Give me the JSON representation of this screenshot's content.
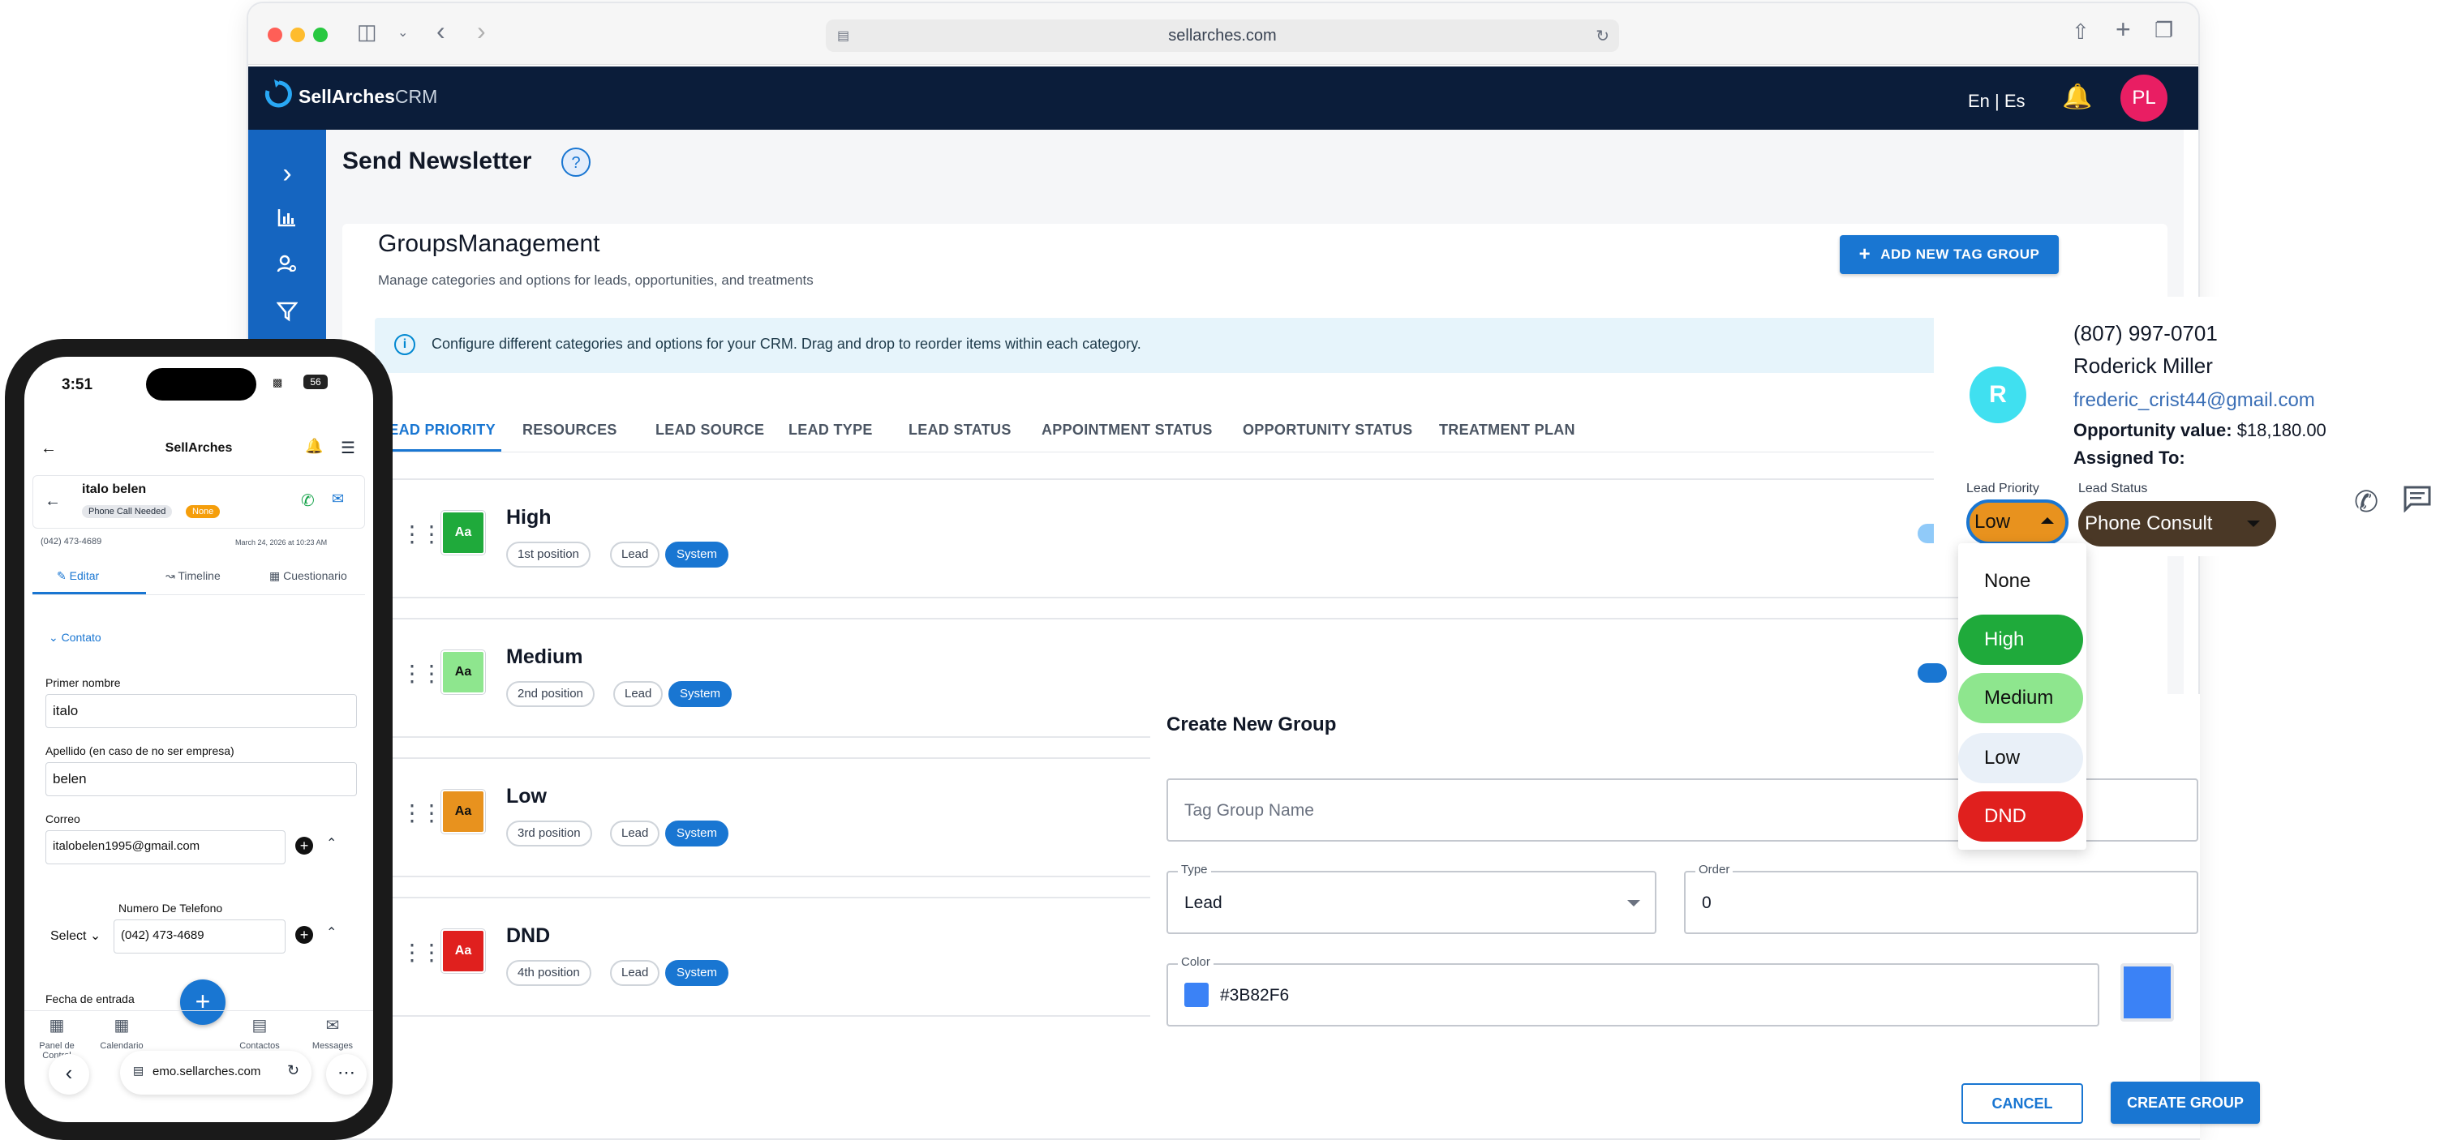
{
  "browser": {
    "url": "sellarches.com"
  },
  "app": {
    "logo_brand": "SellArches",
    "logo_suffix": "CRM",
    "lang": "En | Es",
    "user_initials": "PL"
  },
  "page": {
    "title": "Send Newsletter",
    "help_icon": "?"
  },
  "groups": {
    "title": "GroupsManagement",
    "description": "Manage categories and options for leads, opportunities, and treatments",
    "add_button": "ADD NEW TAG GROUP",
    "info_text": "Configure different categories and options for your CRM. Drag and drop to reorder items within each category.",
    "tabs": [
      "LEAD PRIORITY",
      "RESOURCES",
      "LEAD SOURCE",
      "LEAD TYPE",
      "LEAD STATUS",
      "APPOINTMENT STATUS",
      "OPPORTUNITY STATUS",
      "TREATMENT PLAN"
    ],
    "active_tab": "LEAD PRIORITY",
    "rows": [
      {
        "name": "High",
        "swatch": "Aa",
        "color": "#1faa3b",
        "position": "1st position",
        "type": "Lead",
        "badge": "System"
      },
      {
        "name": "Medium",
        "swatch": "Aa",
        "color": "#8ee68e",
        "position": "2nd position",
        "type": "Lead",
        "badge": "System"
      },
      {
        "name": "Low",
        "swatch": "Aa",
        "color": "#e8921e",
        "position": "3rd position",
        "type": "Lead",
        "badge": "System"
      },
      {
        "name": "DND",
        "swatch": "Aa",
        "color": "#e0201e",
        "position": "4th position",
        "type": "Lead",
        "badge": "System"
      }
    ]
  },
  "dialog": {
    "title": "Create New Group",
    "name_placeholder": "Tag Group Name",
    "type_label": "Type",
    "type_value": "Lead",
    "order_label": "Order",
    "order_value": "0",
    "color_label": "Color",
    "color_value": "#3B82F6",
    "cancel": "CANCEL",
    "create": "CREATE GROUP"
  },
  "lead": {
    "avatar": "R",
    "phone": "(807) 997-0701",
    "name": "Roderick Miller",
    "email": "frederic_crist44@gmail.com",
    "opp_label": "Opportunity value:",
    "opp_value": "$18,180.00",
    "assigned_label": "Assigned To:",
    "priority_label": "Lead Priority",
    "priority_value": "Low",
    "status_label": "Lead Status",
    "status_value": "Phone Consult",
    "priority_options": [
      {
        "label": "None",
        "color": "#ffffff"
      },
      {
        "label": "High",
        "color": "#1faa3b"
      },
      {
        "label": "Medium",
        "color": "#8ee68e"
      },
      {
        "label": "Low",
        "color": "#e9f0f8"
      },
      {
        "label": "DND",
        "color": "#e0201e"
      }
    ]
  },
  "phone": {
    "time": "3:51",
    "battery": "56",
    "app_title": "SellArches",
    "contact_name": "italo belen",
    "tag1": "Phone Call Needed",
    "tag2": "None",
    "contact_phone": "(042) 473-4689",
    "contact_date": "March 24, 2026 at 10:23 AM",
    "tabs": [
      "Editar",
      "Timeline",
      "Cuestionario"
    ],
    "section": "Contato",
    "first_name_label": "Primer nombre",
    "first_name": "italo",
    "last_name_label": "Apellido (en caso de no ser empresa)",
    "last_name": "belen",
    "email_label": "Correo",
    "email": "italobelen1995@gmail.com",
    "phone_label": "Numero De Telefono",
    "phone_select": "Select",
    "phone_value": "(042) 473-4689",
    "date_label": "Fecha de entrada",
    "nav": [
      "Panel de Control",
      "Calendario",
      "Contactos",
      "Messages"
    ],
    "url": "emo.sellarches.com"
  }
}
